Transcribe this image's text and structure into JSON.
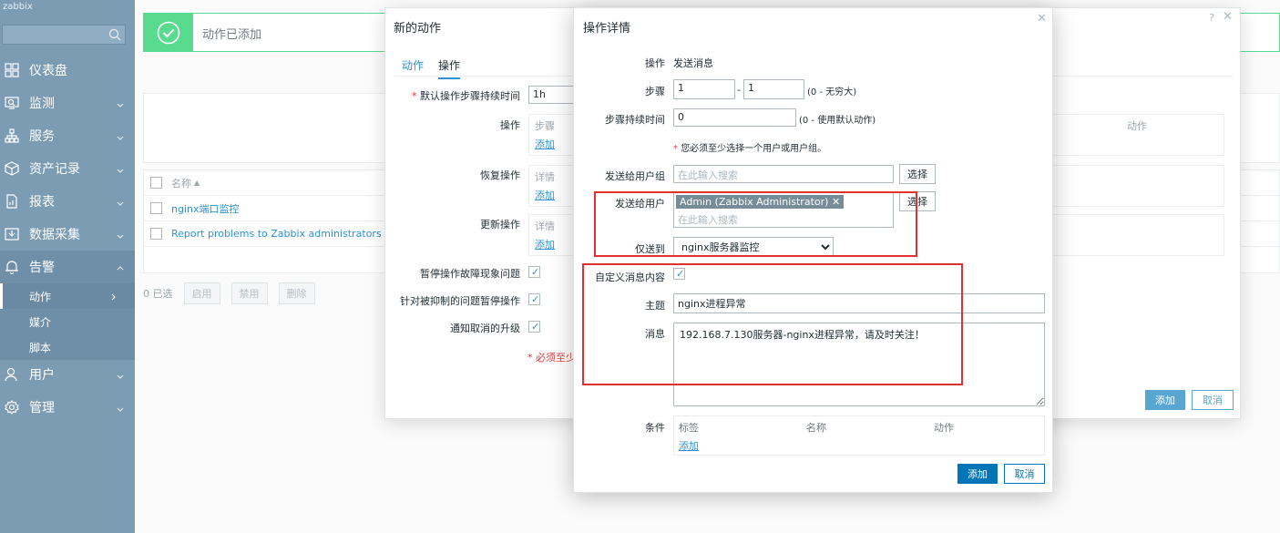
{
  "sidebar": {
    "brand": "zabbix",
    "items": [
      {
        "label": "仪表盘",
        "icon": "dashboard-icon"
      },
      {
        "label": "监测",
        "icon": "monitoring-icon"
      },
      {
        "label": "服务",
        "icon": "services-icon"
      },
      {
        "label": "资产记录",
        "icon": "inventory-icon"
      },
      {
        "label": "报表",
        "icon": "reports-icon"
      },
      {
        "label": "数据采集",
        "icon": "data-collection-icon"
      },
      {
        "label": "告警",
        "icon": "alerts-icon"
      },
      {
        "label": "用户",
        "icon": "users-icon"
      },
      {
        "label": "管理",
        "icon": "administration-icon"
      }
    ],
    "alerts_sub": [
      {
        "label": "动作"
      },
      {
        "label": "媒介"
      },
      {
        "label": "脚本"
      }
    ]
  },
  "notification": {
    "text": "动作已添加"
  },
  "background_table": {
    "column_name": "名称",
    "rows": [
      "nginx端口监控",
      "Report problems to Zabbix administrators"
    ],
    "footer": {
      "selected": "0 已选",
      "enable": "启用",
      "disable": "禁用",
      "delete": "删除"
    }
  },
  "new_action_dialog": {
    "title": "新的动作",
    "help": "?",
    "tabs": [
      "动作",
      "操作"
    ],
    "default_step_duration_label": "默认操作步骤持续时间",
    "default_step_duration_value": "1h",
    "operations_label": "操作",
    "operations_col_steps": "步骤",
    "operations_col_action": "动作",
    "add_link": "添加",
    "recovery_label": "恢复操作",
    "update_label": "更新操作",
    "details_col": "详情",
    "pause_symptoms_label": "暂停操作故障现象问题",
    "pause_suppressed_label": "针对被抑制的问题暂停操作",
    "notify_cancel_label": "通知取消的升级",
    "must_note": "* 必须至少",
    "add_button": "添加",
    "cancel_button": "取消"
  },
  "operation_dialog": {
    "title": "操作详情",
    "operation_label": "操作",
    "operation_value": "发送消息",
    "steps_label": "步骤",
    "step_from": "1",
    "step_sep": "-",
    "step_to": "1",
    "steps_hint": "(0 - 无穷大)",
    "step_duration_label": "步骤持续时间",
    "step_duration_value": "0",
    "step_duration_hint": "(0 - 使用默认动作)",
    "required_note": "您必须至少选择一个用户或用户组。",
    "send_to_groups_label": "发送给用户组",
    "search_placeholder": "在此输入搜索",
    "select_button": "选择",
    "send_to_users_label": "发送给用户",
    "user_tag": "Admin (Zabbix Administrator)",
    "send_only_to_label": "仅送到",
    "send_only_to_value": "nginx服务器监控",
    "custom_message_label": "自定义消息内容",
    "subject_label": "主题",
    "subject_value": "nginx进程异常",
    "message_label": "消息",
    "message_value": "192.168.7.130服务器-nginx进程异常，请及时关注！",
    "conditions_label": "条件",
    "conditions_cols": [
      "标签",
      "名称",
      "动作"
    ],
    "conditions_add": "添加",
    "add_button": "添加",
    "cancel_button": "取消"
  },
  "colors": {
    "sidebar_bg": "#7c9cb4",
    "accent": "#0275b8",
    "link": "#2d92d8",
    "success": "#59db8f",
    "highlight_border": "#e1302f"
  }
}
